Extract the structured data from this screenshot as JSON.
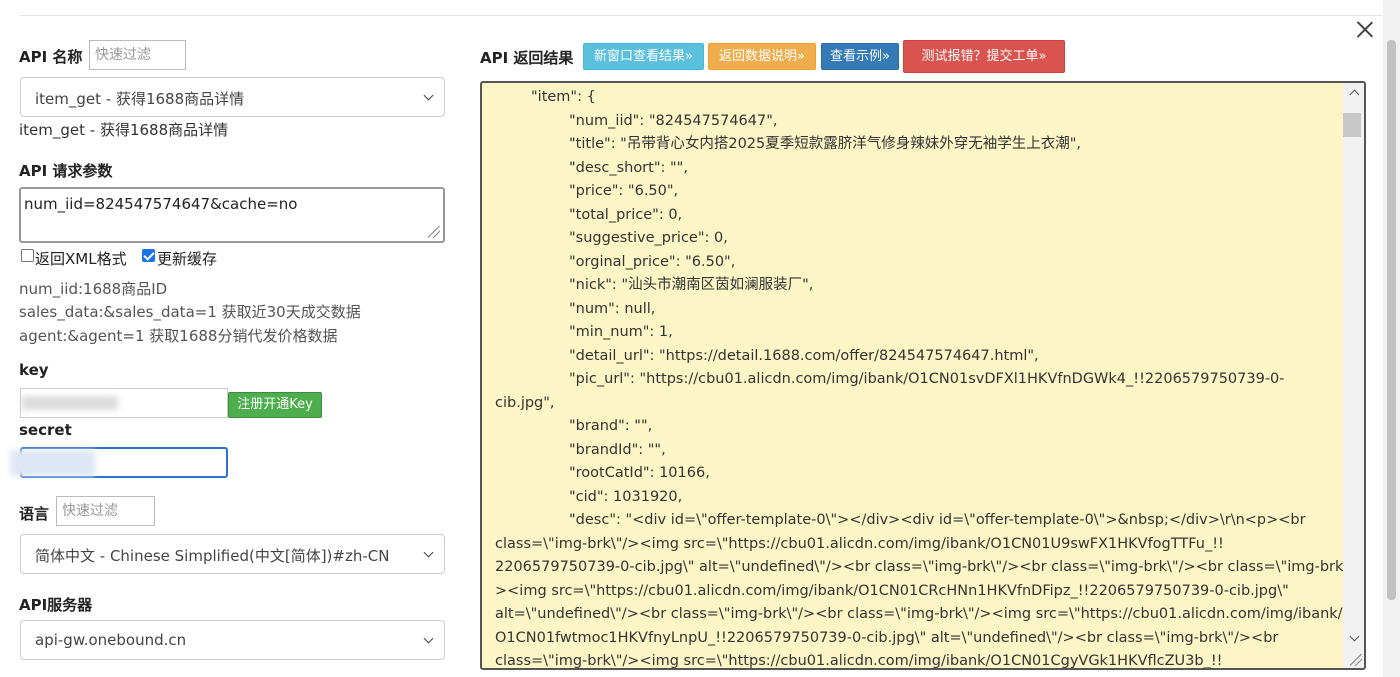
{
  "left": {
    "api_name_label": "API 名称",
    "filter_placeholder": "快速过滤",
    "api_selected": "item_get - 获得1688商品详情",
    "api_selected_text": "item_get - 获得1688商品详情",
    "params_label": "API 请求参数",
    "params_value": "num_iid=824547574647&cache=no",
    "checkbox_xml_label": "返回XML格式",
    "checkbox_xml_checked": false,
    "checkbox_cache_label": "更新缓存",
    "checkbox_cache_checked": true,
    "help_lines": [
      "num_iid:1688商品ID",
      "sales_data:&sales_data=1 获取近30天成交数据",
      "agent:&agent=1 获取1688分销代发价格数据"
    ],
    "key_label": "key",
    "register_button": "注册开通Key",
    "secret_label": "secret",
    "language_label": "语言",
    "language_filter_placeholder": "快速过滤",
    "language_selected": "简体中文 - Chinese Simplified(中文[简体])#zh-CN",
    "server_label": "API服务器",
    "server_selected": "api-gw.onebound.cn"
  },
  "right": {
    "result_label": "API 返回结果",
    "buttons": [
      {
        "label": "新窗口查看结果»",
        "color": "#5bc0de"
      },
      {
        "label": "返回数据说明»",
        "color": "#f0ad4e"
      },
      {
        "label": "查看示例»",
        "color": "#337ab7"
      },
      {
        "label": "测试报错？提交工单»",
        "color": "#d9534f"
      }
    ],
    "result_lines": [
      "\"item\": {",
      "\"num_iid\": \"824547574647\",",
      "\"title\": \"吊带背心女内搭2025夏季短款露脐洋气修身辣妹外穿无袖学生上衣潮\",",
      "\"desc_short\": \"\",",
      "\"price\": \"6.50\",",
      "\"total_price\": 0,",
      "\"suggestive_price\": 0,",
      "\"orginal_price\": \"6.50\",",
      "\"nick\": \"汕头市潮南区茵如澜服装厂\",",
      "\"num\": null,",
      "\"min_num\": 1,",
      "\"detail_url\": \"https://detail.1688.com/offer/824547574647.html\",",
      "\"pic_url\": \"https://cbu01.alicdn.com/img/ibank/O1CN01svDFXl1HKVfnDGWk4_!!2206579750739-0-",
      "cib.jpg\",",
      "\"brand\": \"\",",
      "\"brandId\": \"\",",
      "\"rootCatId\": 10166,",
      "\"cid\": 1031920,",
      "\"desc\": \"<div id=\\\"offer-template-0\\\"></div><div id=\\\"offer-template-0\\\">&nbsp;</div>\\r\\n<p><br",
      "class=\\\"img-brk\\\"/><img src=\\\"https://cbu01.alicdn.com/img/ibank/O1CN01U9swFX1HKVfogTTFu_!!",
      "2206579750739-0-cib.jpg\\\" alt=\\\"undefined\\\"/><br class=\\\"img-brk\\\"/><br class=\\\"img-brk\\\"/><br class=\\\"img-brk\\\"/",
      "><img src=\\\"https://cbu01.alicdn.com/img/ibank/O1CN01CRcHNn1HKVfnDFipz_!!2206579750739-0-cib.jpg\\\"",
      "alt=\\\"undefined\\\"/><br class=\\\"img-brk\\\"/><br class=\\\"img-brk\\\"/><img src=\\\"https://cbu01.alicdn.com/img/ibank/",
      "O1CN01fwtmoc1HKVfnyLnpU_!!2206579750739-0-cib.jpg\\\" alt=\\\"undefined\\\"/><br class=\\\"img-brk\\\"/><br",
      "class=\\\"img-brk\\\"/><img src=\\\"https://cbu01.alicdn.com/img/ibank/O1CN01CgyVGk1HKVflcZU3b_!!"
    ]
  }
}
